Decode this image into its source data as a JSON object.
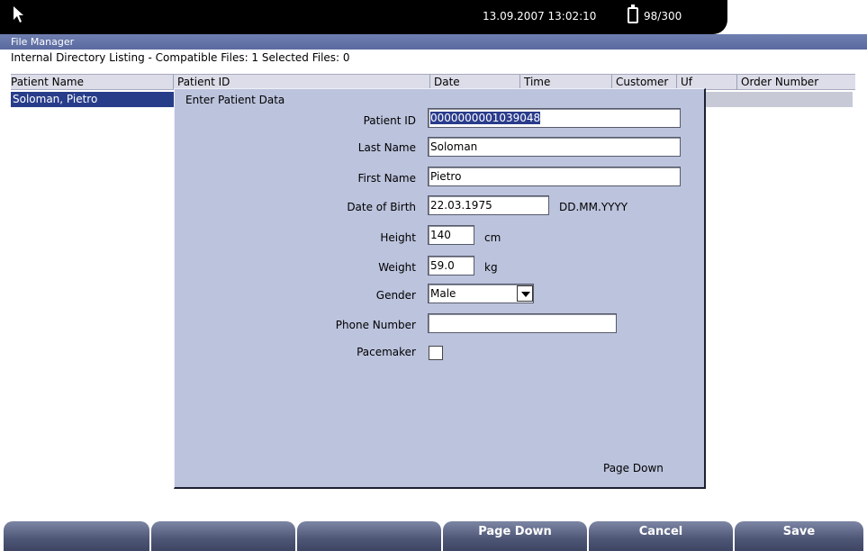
{
  "status_bar": {
    "datetime": "13.09.2007 13:02:10",
    "storage": "98/300"
  },
  "file_manager": {
    "title": "File Manager",
    "listing_text": "Internal Directory Listing  -  Compatible Files: 1   Selected Files: 0"
  },
  "table": {
    "columns": [
      "Patient Name",
      "Patient ID",
      "Date",
      "Time",
      "Customer",
      "Uf",
      "Order Number"
    ],
    "rows": [
      {
        "name": "Soloman, Pietro"
      }
    ]
  },
  "dialog": {
    "title": "Enter Patient Data",
    "fields": {
      "patient_id": {
        "label": "Patient ID",
        "value": "0000000001039048"
      },
      "last_name": {
        "label": "Last Name",
        "value": "Soloman"
      },
      "first_name": {
        "label": "First Name",
        "value": "Pietro"
      },
      "dob": {
        "label": "Date of Birth",
        "value": "22.03.1975",
        "format": "DD.MM.YYYY"
      },
      "height": {
        "label": "Height",
        "value": "140",
        "unit": "cm"
      },
      "weight": {
        "label": "Weight",
        "value": "59.0",
        "unit": "kg"
      },
      "gender": {
        "label": "Gender",
        "value": "Male"
      },
      "phone": {
        "label": "Phone Number",
        "value": ""
      },
      "pacemaker": {
        "label": "Pacemaker",
        "checked": false
      }
    },
    "page_down": "Page Down"
  },
  "softkeys": [
    "",
    "",
    "",
    "Page Down",
    "Cancel",
    "Save"
  ],
  "colors": {
    "selection": "#283d8a",
    "dialog_bg": "#bcc3dd",
    "softkey": "#4e5676"
  }
}
